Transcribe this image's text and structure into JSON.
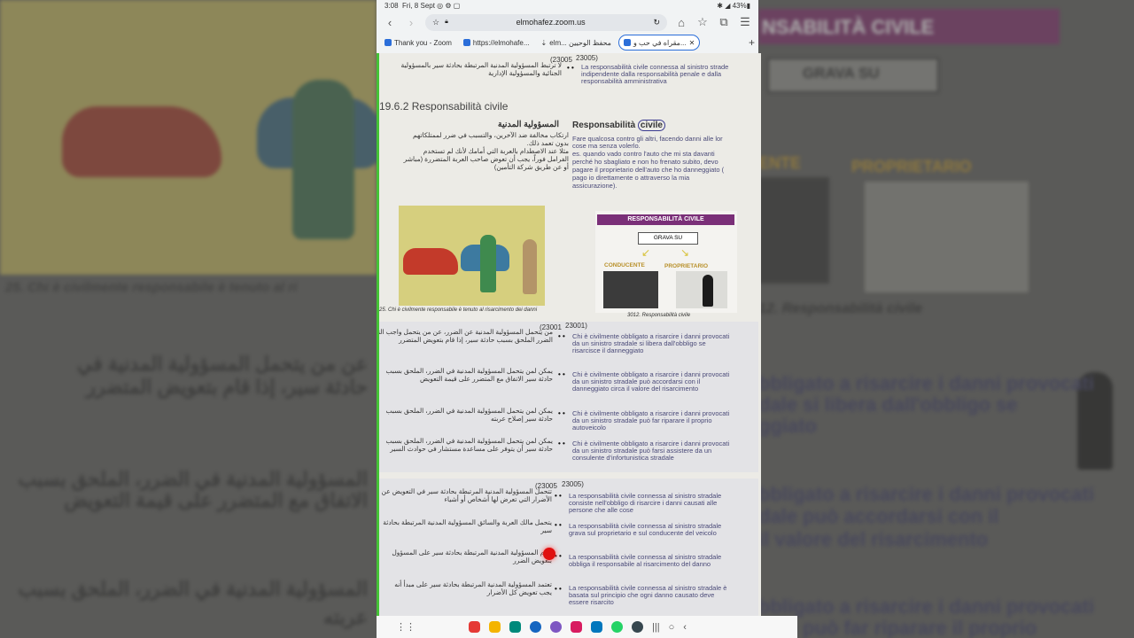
{
  "status": {
    "time": "3:08",
    "date": "Fri, 8 Sept",
    "battery": "43%"
  },
  "browser": {
    "url": "elmohafez.zoom.us",
    "tabs": [
      {
        "label": "Thank you - Zoom"
      },
      {
        "label": "https://elmohafe..."
      },
      {
        "label": "elm... محفظ الوحيين"
      },
      {
        "label": "مقراه في حب و...",
        "active": true
      }
    ]
  },
  "page": {
    "top_num": "(23005",
    "top_num2": "23005)",
    "top_it1": "La responsabilità civile connessa al sinistro strade",
    "top_it2": "indipendente dalla responsabilità penale e dalla",
    "top_it3": "responsabilità amministrativa",
    "top_ar1": "لا ترتبط المسؤولية المدنية المرتبطة بحادثة سير بالمسؤولية",
    "top_ar2": "الجنائية والمسؤولية الإدارية",
    "heading": "19.6.2 Responsabilità civile",
    "ar_heading": "المسؤولية المدنية",
    "respo_word": "Responsabilità",
    "civile_word": "civile",
    "def_it1": "Fare qualcosa contro gli altri, facendo danni alle lor",
    "def_it2": "cose ma senza volerlo.",
    "def_it3": "es. quando vado contro l'auto che mi sta davanti",
    "def_it4": "perché ho sbagliato e non ho frenato subito, devo",
    "def_it5": "pagare il proprietario dell'auto che ho danneggiato (",
    "def_it6": "pago io direttamente o attraverso la mia",
    "def_it7": "assicurazione).",
    "def_ar1": "ارتكاب مخالفة ضد الآخرين، والتسبب في ضرر لممتلكاتهم",
    "def_ar2": "بدون تعمد ذلك.",
    "def_ar3": "مثلا عند الاصطدام بالعربة التي أمامك لأنك لم تستخدم",
    "def_ar4": "الفرامل فوراً، يجب أن تعوض صاحب العربة المتضررة (مباشر",
    "def_ar5": "أو عن طريق شركة التأمين)",
    "caption1": "25. Chi è civilmente responsabile è tenuto al risarcimento dei danni",
    "diag_title": "RESPONSABILITÀ CIVILE",
    "diag_grava": "GRAVA SU",
    "diag_conducente": "CONDUCENTE",
    "diag_proprietario": "PROPRIETARIO",
    "caption2": "3012. Responsabilità civile",
    "q_num": "(23001",
    "q_num2": "23001)",
    "q1_it1": "Chi è civilmente obbligato a risarcire i danni provocati",
    "q1_it2": "da un sinistro stradale si libera dall'obbligo se",
    "q1_it3": "risarcisce il danneggiato",
    "q1_ar1": "من يتحمل المسؤولية المدنية عن الضرر، عن من يتحمل واجب التعويض",
    "q1_ar2": "الضرر الملحق بسبب حادثة سير، إذا قام بتعويض المتضرر",
    "q2_it1": "Chi è civilmente obbligato a risarcire i danni provocati",
    "q2_it2": "da un sinistro stradale può accordarsi con il",
    "q2_it3": "danneggiato circa il valore del risarcimento",
    "q2_ar1": "يمكن لمن يتحمل المسؤولية المدنية في الضرر، الملحق بسبب",
    "q2_ar2": "حادثة سير الاتفاق مع المتضرر على قيمة التعويض",
    "q3_it1": "Chi è civilmente obbligato a risarcire i danni provocati",
    "q3_it2": "da un sinistro stradale può far riparare il proprio",
    "q3_it3": "autoveicolo",
    "q3_ar1": "يمكن لمن يتحمل المسؤولية المدنية في الضرر، الملحق بسبب",
    "q3_ar2": "حادثة سير إصلاح عربته",
    "q4_it1": "Chi è civilmente obbligato a risarcire i danni provocati",
    "q4_it2": "da un sinistro stradale può farsi assistere da un",
    "q4_it3": "consulente d'infortunistica stradale",
    "q4_ar1": "يمكن لمن يتحمل المسؤولية المدنية في الضرر، الملحق بسبب",
    "q4_ar2": "حادثة سير أن يتوفر على مساعدة مستشار في حوادث السير",
    "s2_num": "(23005",
    "s2_num2": "23005)",
    "r1_it1": "La responsabilità civile connessa al sinistro stradale",
    "r1_it2": "consiste nell'obbligo di risarcire i danni causati alle",
    "r1_it3": "persone che alle cose",
    "r1_ar1": "تتحمل المسؤولية المدنية المرتبطة بحادثة سير في التعويض عن",
    "r1_ar2": "الأضرار التي تعرض لها أشخاص أو أشياء",
    "r2_it1": "La responsabilità civile connessa al sinistro stradale",
    "r2_it2": "grava sul proprietario e sul conducente del veicolo",
    "r2_ar1": "يتحمل مالك العربة والسائق المسؤولية المدنية المرتبطة بحادثة",
    "r2_ar2": "سير",
    "r3_it1": "La responsabilità civile connessa al sinistro stradale",
    "r3_it2": "obbliga il responsabile al risarcimento del danno",
    "r3_ar1": "تلزم المسؤولية المدنية المرتبطة بحادثة سير على المسؤول",
    "r3_ar2": "بتعويض الضرر",
    "r4_it1": "La responsabilità civile connessa al sinistro stradale è",
    "r4_it2": "basata sul principio che ogni danno causato deve",
    "r4_it3": "essere risarcito",
    "r4_ar1": "تعتمد المسؤولية المدنية المرتبطة بحادثة سير على مبدأ أنه",
    "r4_ar2": "يجب تعويض كل الأضرار"
  },
  "background": {
    "left_caption": "25. Chi è civilmente responsabile è tenuto al ri",
    "left_ar1": "عن من يتحمل المسؤولية المدنية في",
    "left_ar2": "حادثة سير، إذا قام بتعويض المتضرر",
    "left_ar3": "المسؤولية المدنية في الضرر، الملحق بسبب",
    "left_ar4": "الاتفاق مع المتضرر على قيمة التعويض",
    "left_ar5": "المسؤولية المدنية في الضرر، الملحق بسبب",
    "left_ar6": "عربته",
    "right_title": "NSABILITÀ CIVILE",
    "right_grava": "GRAVA SU",
    "right_ente": "ENTE",
    "right_proprietario": "PROPRIETARIO",
    "right_caption": "12. Responsabilità civile",
    "right_t1": "bbligato a risarcire i danni provocati",
    "right_t2": "dale si libera dall'obbligo se",
    "right_t3": "ggiato",
    "right_t4": "bbligato a risarcire i danni provocati",
    "right_t5": "dale può accordarsi con il",
    "right_t6": "il valore del risarcimento",
    "right_t7": "bbligato a risarcire i danni provocati",
    "right_t8": "dale può far riparare il proprio"
  },
  "colors": {
    "accent": "#2b6ed9",
    "green_edge": "#45c236",
    "purple_bar": "#7a2f78",
    "cursor": "#e01010"
  }
}
